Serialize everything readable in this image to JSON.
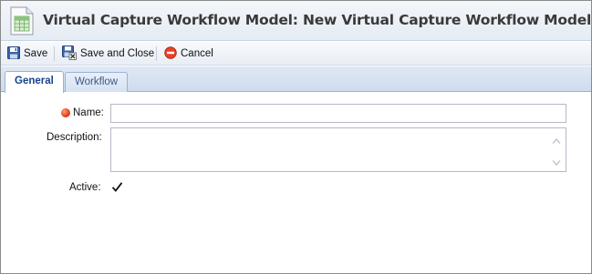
{
  "window": {
    "title": "Virtual Capture Workflow Model: New Virtual Capture Workflow Model",
    "icon": "spreadsheet-document-icon"
  },
  "toolbar": {
    "save_label": "Save",
    "save_close_label": "Save and Close",
    "cancel_label": "Cancel"
  },
  "tabs": [
    {
      "label": "General",
      "active": true
    },
    {
      "label": "Workflow",
      "active": false
    }
  ],
  "form": {
    "name": {
      "label": "Name:",
      "value": "",
      "required": true
    },
    "description": {
      "label": "Description:",
      "value": ""
    },
    "active": {
      "label": "Active:",
      "checked": true
    }
  },
  "colors": {
    "tab_active_text": "#15428b",
    "required_marker": "#e0401a",
    "tab_border": "#99b2d3"
  }
}
